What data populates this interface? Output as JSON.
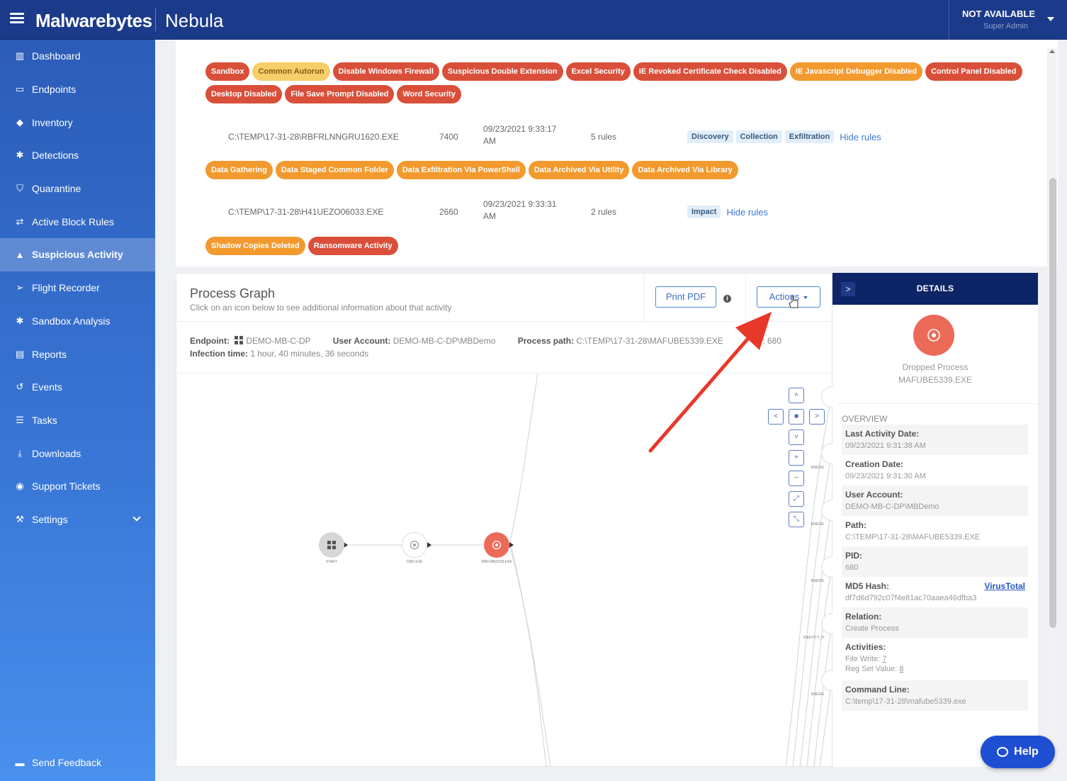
{
  "header": {
    "logo": "Malwarebytes",
    "product": "Nebula",
    "user_name": "NOT AVAILABLE",
    "user_role": "Super Admin"
  },
  "sidebar": {
    "items": [
      {
        "label": "Dashboard",
        "icon": "bar-chart-icon",
        "glyph": "▥"
      },
      {
        "label": "Endpoints",
        "icon": "monitor-icon",
        "glyph": "▭"
      },
      {
        "label": "Inventory",
        "icon": "tag-icon",
        "glyph": "◆"
      },
      {
        "label": "Detections",
        "icon": "bug-icon",
        "glyph": "✱"
      },
      {
        "label": "Quarantine",
        "icon": "shield-icon",
        "glyph": "⛉"
      },
      {
        "label": "Active Block Rules",
        "icon": "exchange-icon",
        "glyph": "⇄"
      },
      {
        "label": "Suspicious Activity",
        "icon": "flask-icon",
        "glyph": "▲",
        "active": true
      },
      {
        "label": "Flight Recorder",
        "icon": "paper-plane-icon",
        "glyph": "➢"
      },
      {
        "label": "Sandbox Analysis",
        "icon": "bug-icon",
        "glyph": "✱"
      },
      {
        "label": "Reports",
        "icon": "document-icon",
        "glyph": "▤"
      },
      {
        "label": "Events",
        "icon": "history-icon",
        "glyph": "↺"
      },
      {
        "label": "Tasks",
        "icon": "list-icon",
        "glyph": "☰"
      },
      {
        "label": "Downloads",
        "icon": "download-icon",
        "glyph": "⤓"
      },
      {
        "label": "Support Tickets",
        "icon": "chat-icon",
        "glyph": "◉"
      },
      {
        "label": "Settings",
        "icon": "wrench-icon",
        "glyph": "⚒"
      }
    ],
    "feedback": "Send Feedback"
  },
  "tags": {
    "row1": [
      {
        "label": "Sandbox",
        "tone": "red"
      },
      {
        "label": "Common Autorun",
        "tone": "yellow"
      },
      {
        "label": "Disable Windows Firewall",
        "tone": "red"
      },
      {
        "label": "Suspicious Double Extension",
        "tone": "red"
      },
      {
        "label": "Excel Security",
        "tone": "red"
      },
      {
        "label": "IE Revoked Certificate Check Disabled",
        "tone": "red"
      },
      {
        "label": "IE Javascript Debugger Disabled",
        "tone": "orange"
      },
      {
        "label": "Control Panel Disabled",
        "tone": "red"
      }
    ],
    "row2": [
      {
        "label": "Desktop Disabled",
        "tone": "red"
      },
      {
        "label": "File Save Prompt Disabled",
        "tone": "red"
      },
      {
        "label": "Word Security",
        "tone": "red"
      }
    ],
    "row3": [
      {
        "label": "Data Gathering",
        "tone": "orange"
      },
      {
        "label": "Data Staged Common Folder",
        "tone": "orange"
      },
      {
        "label": "Data Exfiltration Via PowerShell",
        "tone": "orange"
      },
      {
        "label": "Data Archived Via Utility",
        "tone": "orange"
      },
      {
        "label": "Data Archived Via Library",
        "tone": "orange"
      }
    ],
    "row4": [
      {
        "label": "Shadow Copies Deleted",
        "tone": "orange"
      },
      {
        "label": "Ransomware Activity",
        "tone": "red"
      }
    ]
  },
  "processes": [
    {
      "path": "C:\\TEMP\\17-31-28\\RBFRLNNGRU1620.EXE",
      "pid": "7400",
      "date": "09/23/2021 9:33:17",
      "time_suffix": "AM",
      "rules": "5 rules",
      "tactics": [
        "Discovery",
        "Collection",
        "Exfiltration"
      ],
      "hide": "Hide rules"
    },
    {
      "path": "C:\\TEMP\\17-31-28\\H41UEZO06033.EXE",
      "pid": "2660",
      "date": "09/23/2021 9:33:31",
      "time_suffix": "AM",
      "rules": "2 rules",
      "tactics": [
        "Impact"
      ],
      "hide": "Hide rules"
    }
  ],
  "graph": {
    "title": "Process Graph",
    "subtitle": "Click on an icon below to see additional information about that activity",
    "print_label": "Print PDF",
    "info_glyph": "i",
    "actions_label": "Actions",
    "endpoint_label": "Endpoint:",
    "endpoint_value": "DEMO-MB-C-DP",
    "user_label": "User Account:",
    "user_value": "DEMO-MB-C-DP\\MBDemo",
    "path_label": "Process path:",
    "path_value": "C:\\TEMP\\17-31-28\\MAFUBE5339.EXE",
    "pid_partial": ": 680",
    "infection_label": "Infection time:",
    "infection_value": "1 hour, 40 minutes, 36 seconds",
    "nodes": [
      {
        "label": "START",
        "icon": "windows-icon"
      },
      {
        "label": "CMD.EXE",
        "icon": "process-icon"
      },
      {
        "label": "MAFUBE5339.EXE",
        "icon": "process-icon"
      }
    ],
    "right_node_labels": [
      "MSEDG",
      "MSEDG",
      "MSEDG",
      "MSEDG",
      "IDENTITY_H",
      "MSEDG"
    ],
    "controls": [
      {
        "name": "pan-up-button",
        "glyph": "˄"
      },
      {
        "name": "pan-left-button",
        "glyph": "<"
      },
      {
        "name": "pan-center-button",
        "glyph": "■"
      },
      {
        "name": "pan-right-button",
        "glyph": ">"
      },
      {
        "name": "pan-down-button",
        "glyph": "˅"
      },
      {
        "name": "zoom-in-button",
        "glyph": "+"
      },
      {
        "name": "zoom-out-button",
        "glyph": "−"
      },
      {
        "name": "expand-button",
        "glyph": "⤢"
      },
      {
        "name": "shrink-button",
        "glyph": "⤡"
      }
    ]
  },
  "details": {
    "toggle": ">",
    "title": "DETAILS",
    "kind": "Dropped Process",
    "file": "MAFUBE5339.EXE",
    "overview": "OVERVIEW",
    "last_activity_label": "Last Activity Date:",
    "last_activity_value": "09/23/2021 9:31:38 AM",
    "creation_label": "Creation Date:",
    "creation_value": "09/23/2021 9:31:30 AM",
    "user_label": "User Account:",
    "user_value": "DEMO-MB-C-DP\\MBDemo",
    "path_label": "Path:",
    "path_value": "C:\\TEMP\\17-31-28\\MAFUBE5339.EXE",
    "pid_label": "PID:",
    "pid_value": "680",
    "md5_label": "MD5 Hash:",
    "md5_link": "VirusTotal",
    "md5_value": "df7d6d792c07f4e81ac70aaea46dfba3",
    "relation_label": "Relation:",
    "relation_value": "Create Process",
    "activities_label": "Activities:",
    "file_write_label": "File Write:",
    "file_write_value": "7",
    "reg_set_label": "Reg Set Value:",
    "reg_set_value": "8",
    "cmd_label": "Command Line:",
    "cmd_value": "C:\\temp\\17-31-28\\mafube5339.exe"
  },
  "help_label": "Help",
  "colors": {
    "brand_dark": "#1b3a8a",
    "accent_red": "#ec6a58",
    "annotation_arrow": "#e8382a"
  }
}
